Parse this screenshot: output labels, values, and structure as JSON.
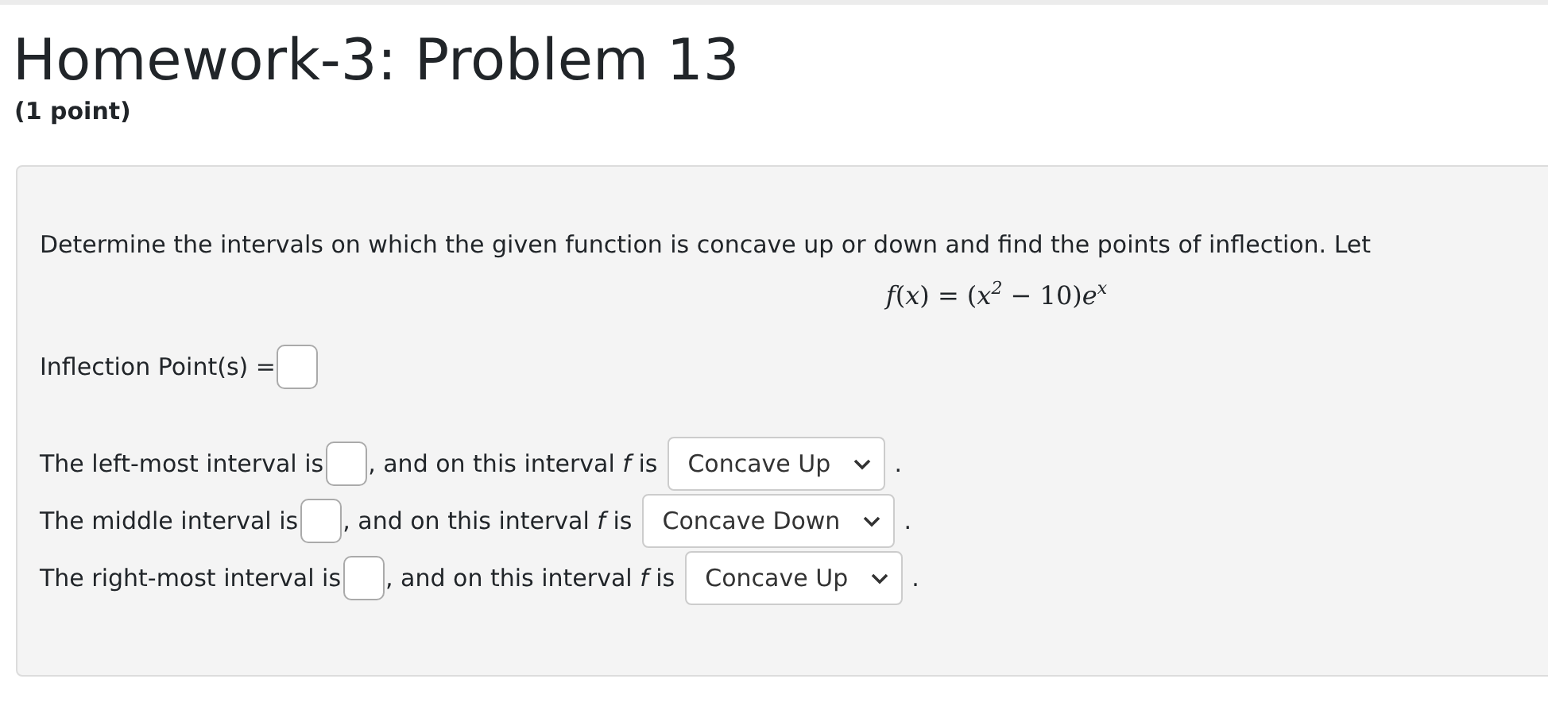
{
  "title": "Homework-3: Problem 13",
  "points": "(1 point)",
  "problem": {
    "statement": "Determine the intervals on which the given function is concave up or down and find the points of inflection. Let",
    "formula": "*f*(*x*) = (*x*$^{2}$ − 10)*e*$^{x}$",
    "inflection": {
      "label": "Inflection Point(s) ="
    },
    "intervals": [
      {
        "lead": "The left-most interval is",
        "middle": ", and on this interval *f* is",
        "choice": "Concave Up",
        "end": "."
      },
      {
        "lead": "The middle interval is",
        "middle": ", and on this interval *f* is",
        "choice": "Concave Down",
        "end": "."
      },
      {
        "lead": "The right-most interval is",
        "middle": ", and on this interval *f* is",
        "choice": "Concave Up",
        "end": "."
      }
    ]
  }
}
